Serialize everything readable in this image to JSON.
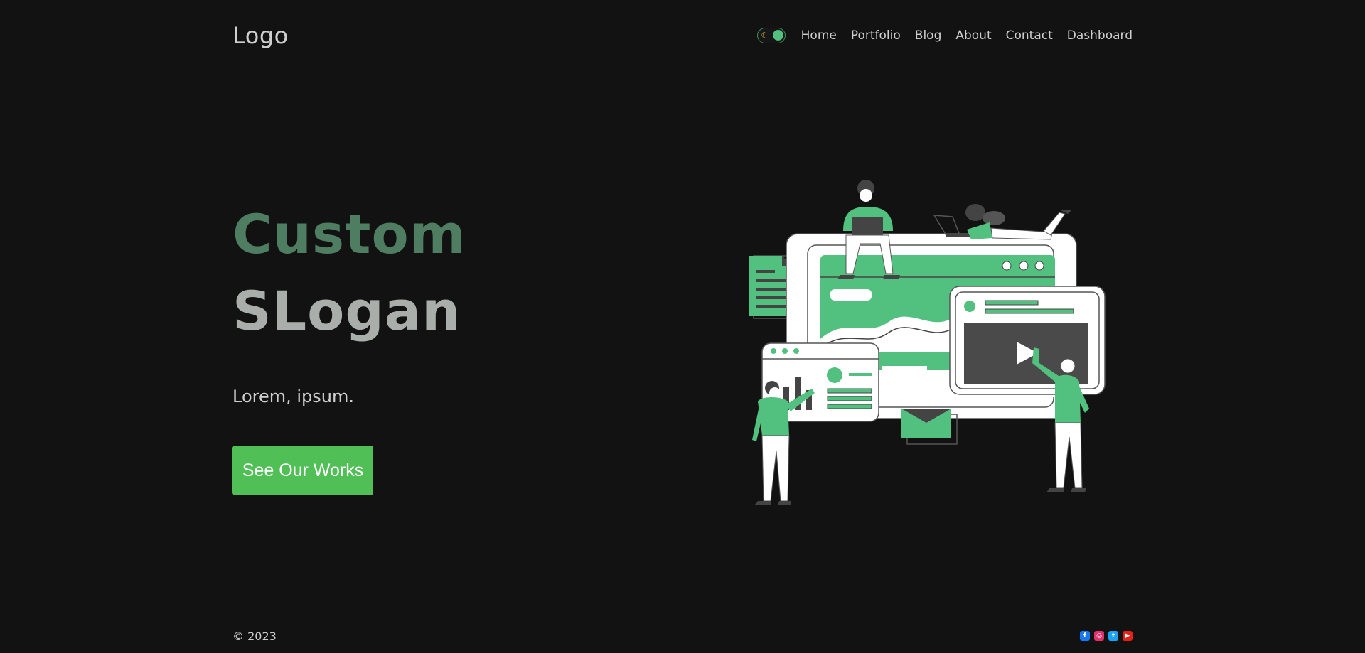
{
  "header": {
    "logo": "Logo",
    "theme_toggle": {
      "icon": "moon-icon",
      "state": "dark"
    },
    "nav": [
      {
        "label": "Home"
      },
      {
        "label": "Portfolio"
      },
      {
        "label": "Blog"
      },
      {
        "label": "About"
      },
      {
        "label": "Contact"
      },
      {
        "label": "Dashboard"
      }
    ]
  },
  "hero": {
    "title": "Custom",
    "subtitle": "SLogan",
    "tagline": "Lorem, ipsum.",
    "cta_label": "See Our Works"
  },
  "footer": {
    "copyright": "© 2023",
    "socials": [
      {
        "name": "facebook-icon",
        "glyph": "f",
        "color": "#1877f2"
      },
      {
        "name": "instagram-icon",
        "glyph": "◎",
        "color": "#e1306c"
      },
      {
        "name": "twitter-icon",
        "glyph": "t",
        "color": "#1da1f2"
      },
      {
        "name": "youtube-icon",
        "glyph": "▶",
        "color": "#e62117"
      }
    ]
  },
  "colors": {
    "background": "#121212",
    "accent": "#52c07e",
    "button": "#4fbf56",
    "title": "#4e7d62",
    "subtitle": "#a9aeab"
  }
}
